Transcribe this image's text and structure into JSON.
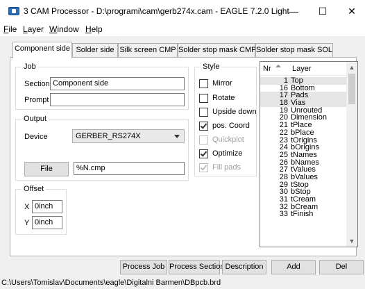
{
  "window": {
    "title": "3 CAM Processor - D:\\programi\\cam\\gerb274x.cam - EAGLE 7.2.0 Light",
    "minimize_glyph": "—",
    "maximize_glyph": "☐",
    "close_glyph": "✕"
  },
  "menu": {
    "file": {
      "key": "F",
      "rest": "ile"
    },
    "layer": {
      "key": "L",
      "rest": "ayer"
    },
    "window": {
      "key": "W",
      "rest": "indow"
    },
    "help": {
      "key": "H",
      "rest": "elp"
    }
  },
  "tabs": [
    {
      "label": "Component side"
    },
    {
      "label": "Solder side"
    },
    {
      "label": "Silk screen CMP"
    },
    {
      "label": "Solder stop mask CMP"
    },
    {
      "label": "Solder stop mask SOL"
    }
  ],
  "job": {
    "title": "Job",
    "section_label": "Section",
    "section_value": "Component side",
    "prompt_label": "Prompt",
    "prompt_value": ""
  },
  "output": {
    "title": "Output",
    "device_label": "Device",
    "device_value": "GERBER_RS274X",
    "file_button": "File",
    "file_value": "%N.cmp"
  },
  "offset": {
    "title": "Offset",
    "x_label": "X",
    "x_value": "0inch",
    "y_label": "Y",
    "y_value": "0inch"
  },
  "style": {
    "title": "Style",
    "options": [
      {
        "label": "Mirror",
        "checked": false,
        "enabled": true
      },
      {
        "label": "Rotate",
        "checked": false,
        "enabled": true
      },
      {
        "label": "Upside down",
        "checked": false,
        "enabled": true
      },
      {
        "label": "pos. Coord",
        "checked": true,
        "enabled": true
      },
      {
        "label": "Quickplot",
        "checked": false,
        "enabled": false
      },
      {
        "label": "Optimize",
        "checked": true,
        "enabled": true
      },
      {
        "label": "Fill pads",
        "checked": true,
        "enabled": false
      }
    ]
  },
  "layers": {
    "col_nr": "Nr",
    "col_layer": "Layer",
    "rows": [
      {
        "nr": "1",
        "name": "Top",
        "selected": true
      },
      {
        "nr": "16",
        "name": "Bottom",
        "selected": false
      },
      {
        "nr": "17",
        "name": "Pads",
        "selected": true
      },
      {
        "nr": "18",
        "name": "Vias",
        "selected": true
      },
      {
        "nr": "19",
        "name": "Unrouted",
        "selected": false
      },
      {
        "nr": "20",
        "name": "Dimension",
        "selected": false
      },
      {
        "nr": "21",
        "name": "tPlace",
        "selected": false
      },
      {
        "nr": "22",
        "name": "bPlace",
        "selected": false
      },
      {
        "nr": "23",
        "name": "tOrigins",
        "selected": false
      },
      {
        "nr": "24",
        "name": "bOrigins",
        "selected": false
      },
      {
        "nr": "25",
        "name": "tNames",
        "selected": false
      },
      {
        "nr": "26",
        "name": "bNames",
        "selected": false
      },
      {
        "nr": "27",
        "name": "tValues",
        "selected": false
      },
      {
        "nr": "28",
        "name": "bValues",
        "selected": false
      },
      {
        "nr": "29",
        "name": "tStop",
        "selected": false
      },
      {
        "nr": "30",
        "name": "bStop",
        "selected": false
      },
      {
        "nr": "31",
        "name": "tCream",
        "selected": false
      },
      {
        "nr": "32",
        "name": "bCream",
        "selected": false
      },
      {
        "nr": "33",
        "name": "tFinish",
        "selected": false
      }
    ]
  },
  "buttons": {
    "process_job": "Process Job",
    "process_section": "Process Section",
    "description": "Description",
    "add": "Add",
    "del": "Del"
  },
  "status": {
    "path": "C:\\Users\\Tomislav\\Documents\\eagle\\Digitalni Barmen\\DBpcb.brd"
  }
}
